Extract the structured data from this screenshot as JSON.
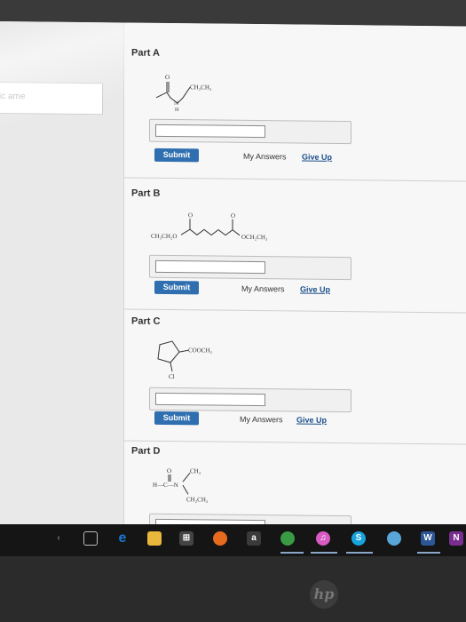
{
  "left_panel": {
    "input_placeholder": "ic ame"
  },
  "parts": [
    {
      "title": "Part A",
      "molecule": {
        "labels": [
          "O",
          "CH₂CH₃",
          "N",
          "H"
        ]
      },
      "submit_label": "Submit",
      "my_answers": "My Answers",
      "give_up": "Give Up"
    },
    {
      "title": "Part B",
      "molecule": {
        "labels": [
          "O",
          "O",
          "CH₃CH₂O",
          "OCH₂CH₃"
        ]
      },
      "submit_label": "Submit",
      "my_answers": "My Answers",
      "give_up": "Give Up"
    },
    {
      "title": "Part C",
      "molecule": {
        "labels": [
          "COOCH₃",
          "Cl"
        ]
      },
      "submit_label": "Submit",
      "my_answers": "My Answers",
      "give_up": "Give Up"
    },
    {
      "title": "Part D",
      "molecule": {
        "labels": [
          "O",
          "CH₃",
          "H—C—N",
          "CH₂CH₃"
        ]
      }
    }
  ],
  "taskbar": {
    "icons": [
      {
        "name": "task-view-icon",
        "glyph": "▯",
        "color": "#151515"
      },
      {
        "name": "edge-icon",
        "glyph": "e",
        "color": "#1b77d2"
      },
      {
        "name": "file-explorer-icon",
        "glyph": "▬",
        "color": "#e8b73c"
      },
      {
        "name": "store-icon",
        "glyph": "⊞",
        "color": "#2a2a2a"
      },
      {
        "name": "firefox-icon",
        "glyph": "●",
        "color": "#e66b1f"
      },
      {
        "name": "amazon-icon",
        "glyph": "a",
        "color": "#2c2c2c"
      },
      {
        "name": "chrome-icon",
        "glyph": "●",
        "color": "#3a9b45"
      },
      {
        "name": "itunes-icon",
        "glyph": "♫",
        "color": "#d85ac2"
      },
      {
        "name": "skype-icon",
        "glyph": "S",
        "color": "#17a3dd"
      },
      {
        "name": "globe-icon",
        "glyph": "●",
        "color": "#5aa6d8"
      },
      {
        "name": "word-icon",
        "glyph": "W",
        "color": "#2b5797"
      },
      {
        "name": "onenote-icon",
        "glyph": "N",
        "color": "#7a2e90"
      }
    ]
  },
  "brand": {
    "logo_text": "hp"
  }
}
